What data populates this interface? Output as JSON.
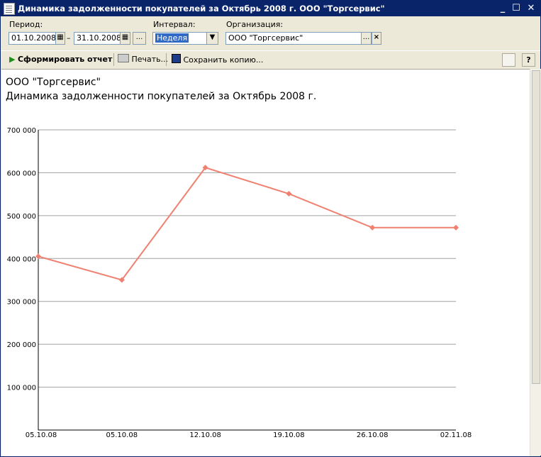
{
  "window": {
    "title": "Динамика задолженности покупателей за Октябрь 2008 г. ООО \"Торгсервис\""
  },
  "params": {
    "period_label": "Период:",
    "date_from": "01.10.2008",
    "dash": "–",
    "date_to": "31.10.2008",
    "more_label": "...",
    "interval_label": "Интервал:",
    "interval_value": "Неделя",
    "org_label": "Организация:",
    "org_value": "ООО \"Торгсервис\"",
    "org_more": "...",
    "org_clear": "×"
  },
  "toolbar": {
    "generate_label": "Сформировать отчет",
    "print_label": "Печать...",
    "save_label": "Сохранить копию..."
  },
  "report": {
    "org_title": "ООО \"Торгсервис\"",
    "title": "Динамика задолженности покупателей за Октябрь 2008 г."
  },
  "chart_data": {
    "type": "line",
    "x": [
      "05.10.08",
      "05.10.08",
      "12.10.08",
      "19.10.08",
      "26.10.08",
      "02.11.08"
    ],
    "series": [
      {
        "values": [
          405000,
          350000,
          612000,
          551000,
          472000,
          472000
        ],
        "color": "#f08070"
      }
    ],
    "ylim": [
      0,
      700000
    ],
    "yticks": [
      "700 000",
      "600 000",
      "500 000",
      "400 000",
      "300 000",
      "200 000",
      "100 000"
    ],
    "ytick_values": [
      700000,
      600000,
      500000,
      400000,
      300000,
      200000,
      100000
    ],
    "grid": true,
    "gridline_color": "#a0a0a0"
  }
}
